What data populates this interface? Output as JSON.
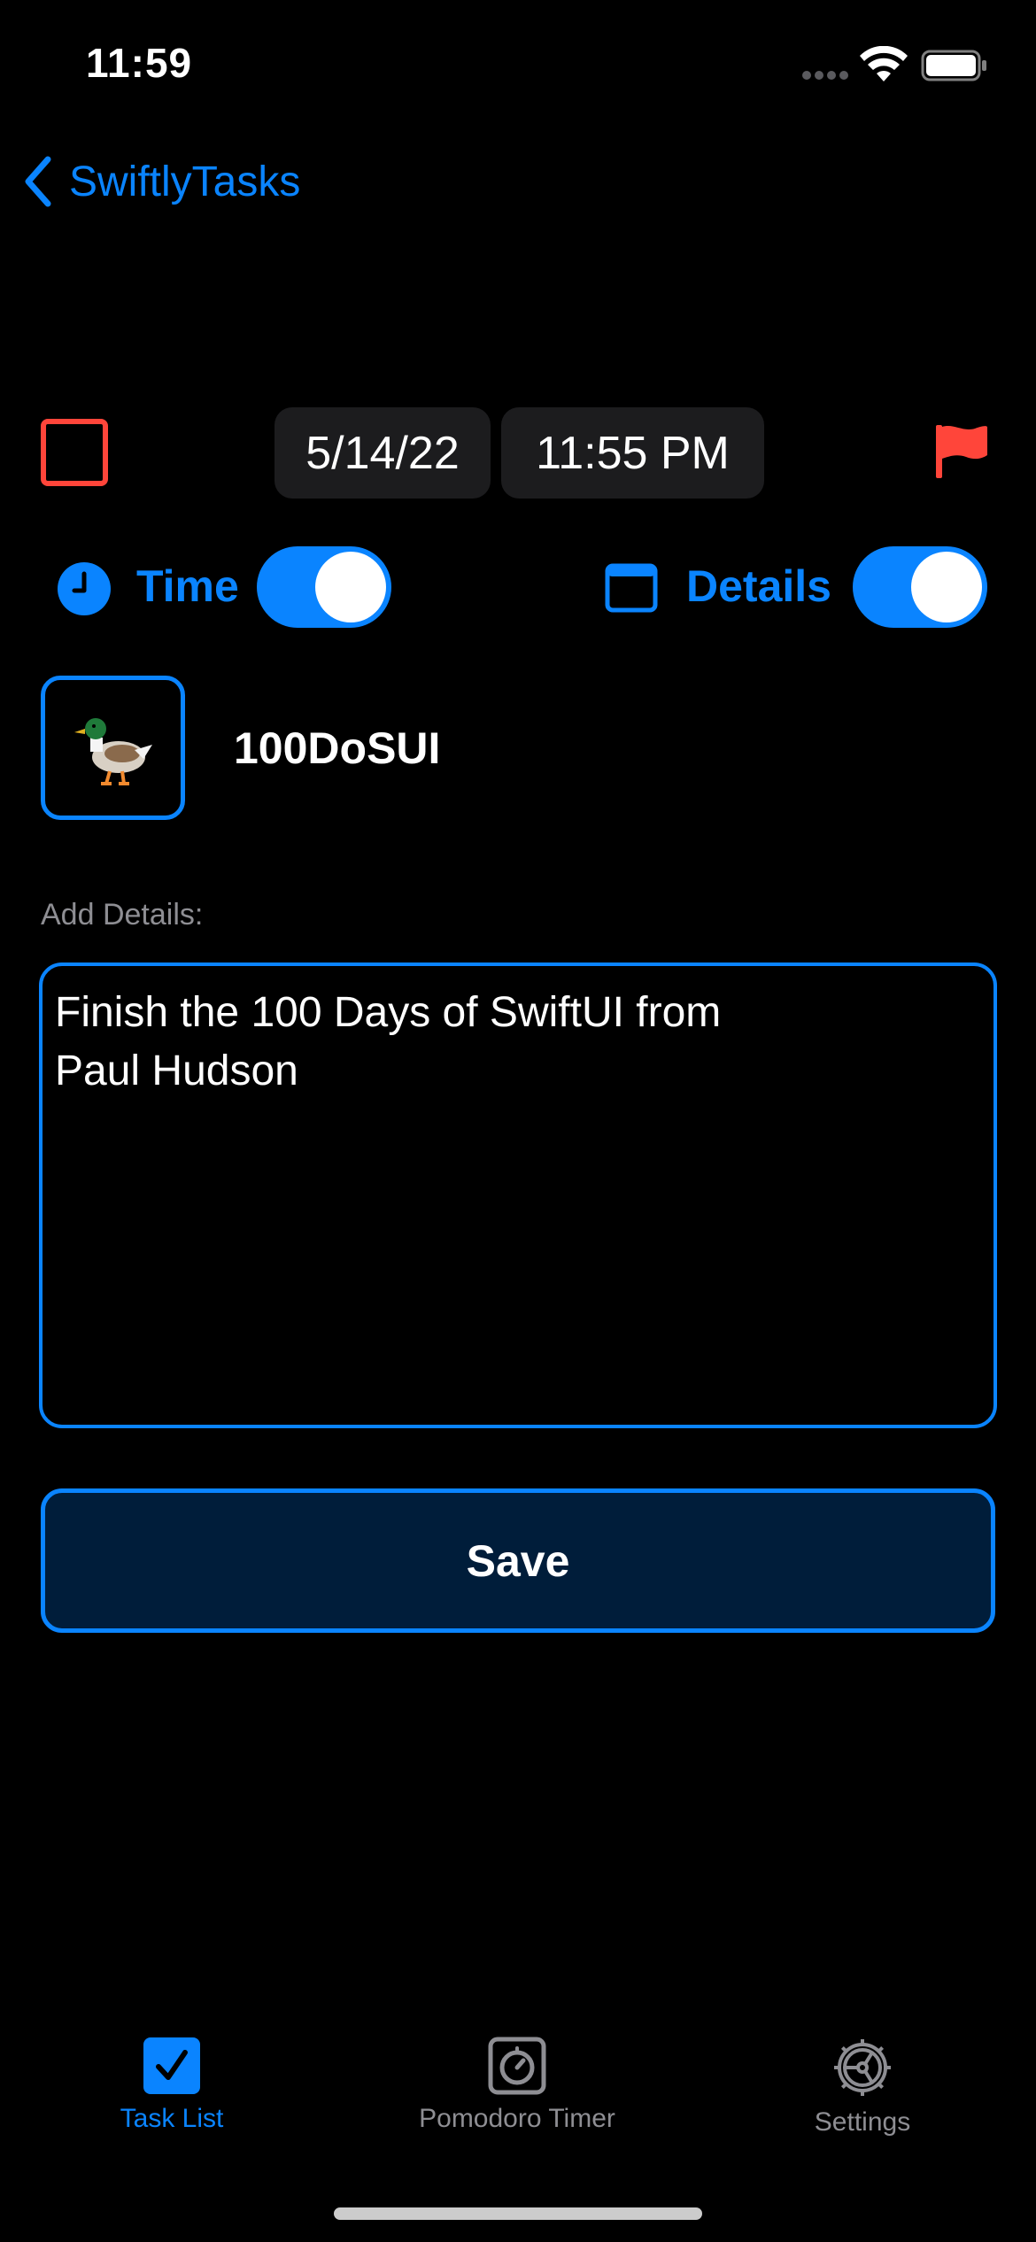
{
  "status_bar": {
    "time": "11:59"
  },
  "nav": {
    "back_label": "SwiftlyTasks"
  },
  "task": {
    "date": "5/14/22",
    "time": "11:55 PM",
    "title": "100DoSUI",
    "emoji": "🦆",
    "completed": false,
    "flagged": true
  },
  "toggles": {
    "time_label": "Time",
    "time_on": true,
    "details_label": "Details",
    "details_on": true
  },
  "details": {
    "label": "Add Details:",
    "value": "Finish the 100 Days of SwiftUI from\nPaul Hudson"
  },
  "save_label": "Save",
  "tabs": [
    {
      "label": "Task List",
      "icon": "checkmark-square-icon",
      "active": true
    },
    {
      "label": "Pomodoro Timer",
      "icon": "timer-icon",
      "active": false
    },
    {
      "label": "Settings",
      "icon": "gear-icon",
      "active": false
    }
  ],
  "colors": {
    "accent": "#0a84ff",
    "danger": "#ff453a",
    "background": "#000000",
    "pill": "#1c1c1e",
    "secondary_text": "#8e8e93"
  }
}
